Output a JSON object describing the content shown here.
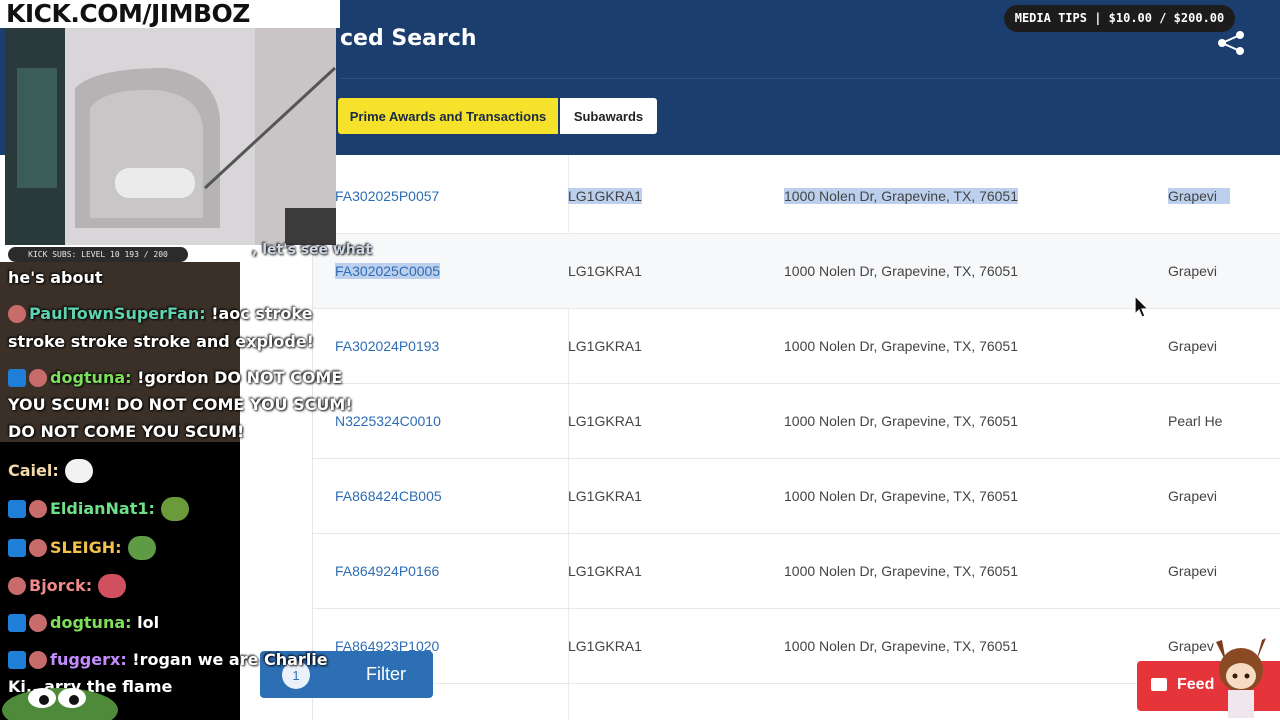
{
  "page": {
    "title": "ced Search",
    "tabs": [
      {
        "label": "Prime Awards and Transactions",
        "active": true
      },
      {
        "label": "Subawards",
        "active": false
      }
    ],
    "share_icon": "share-icon"
  },
  "results": {
    "rows": [
      {
        "award_id": "FA302025P0057",
        "uei": "LG1GKRA1",
        "address": "1000 Nolen Dr, Grapevine, TX, 76051",
        "city": "Grapevi"
      },
      {
        "award_id": "FA302025C0005",
        "uei": "LG1GKRA1",
        "address": "1000 Nolen Dr, Grapevine, TX, 76051",
        "city": "Grapevi"
      },
      {
        "award_id": "FA302024P0193",
        "uei": "LG1GKRA1",
        "address": "1000 Nolen Dr, Grapevine, TX, 76051",
        "city": "Grapevi"
      },
      {
        "award_id": "N3225324C0010",
        "uei": "LG1GKRA1",
        "address": "1000 Nolen Dr, Grapevine, TX, 76051",
        "city": "Pearl He"
      },
      {
        "award_id": "FA868424CB005",
        "uei": "LG1GKRA1",
        "address": "1000 Nolen Dr, Grapevine, TX, 76051",
        "city": "Grapevi"
      },
      {
        "award_id": "FA864924P0166",
        "uei": "LG1GKRA1",
        "address": "1000 Nolen Dr, Grapevine, TX, 76051",
        "city": "Grapevi"
      },
      {
        "award_id": "FA864923P1020",
        "uei": "LG1GKRA1",
        "address": "1000 Nolen Dr, Grapevine, TX, 76051",
        "city": "Grapev"
      }
    ]
  },
  "filter_button": {
    "count": "1",
    "label": "Filter"
  },
  "feedback_button": {
    "label": "Feed"
  },
  "overlay": {
    "channel": "KICK.COM/JIMBOZ",
    "subs": "KICK SUBS: LEVEL 10 193 / 200",
    "tips": "MEDIA TIPS | $10.00 / $200.00",
    "chat_partial_top": ", let's see what",
    "chat": [
      {
        "user": "",
        "text": "he's about",
        "color": "#ffffff"
      },
      {
        "user": "PaulTownSuperFan:",
        "text": "!aoc stroke",
        "cont": "stroke stroke stroke and explode!",
        "color": "#5fd3b0"
      },
      {
        "user": "dogtuna:",
        "text": "!gordon DO NOT COME",
        "cont": "YOU SCUM! DO NOT COME YOU SCUM!",
        "cont2": "DO NOT COME YOU SCUM!",
        "color": "#7ee05a"
      },
      {
        "user": "Caiel:",
        "text": "",
        "color": "#f5d9a8"
      },
      {
        "user": "EldianNat1:",
        "text": "",
        "color": "#6ee08a"
      },
      {
        "user": "SLEIGH:",
        "text": "",
        "color": "#f2c14e"
      },
      {
        "user": "Bjorck:",
        "text": "",
        "color": "#f08a8a"
      },
      {
        "user": "dogtuna:",
        "text": "lol",
        "color": "#7ee05a"
      },
      {
        "user": "fuggerx:",
        "text": "!rogan we are Charlie",
        "color": "#c48cff"
      },
      {
        "user": "",
        "text": "Ki...arry the flame",
        "color": "#ffffff"
      }
    ]
  }
}
